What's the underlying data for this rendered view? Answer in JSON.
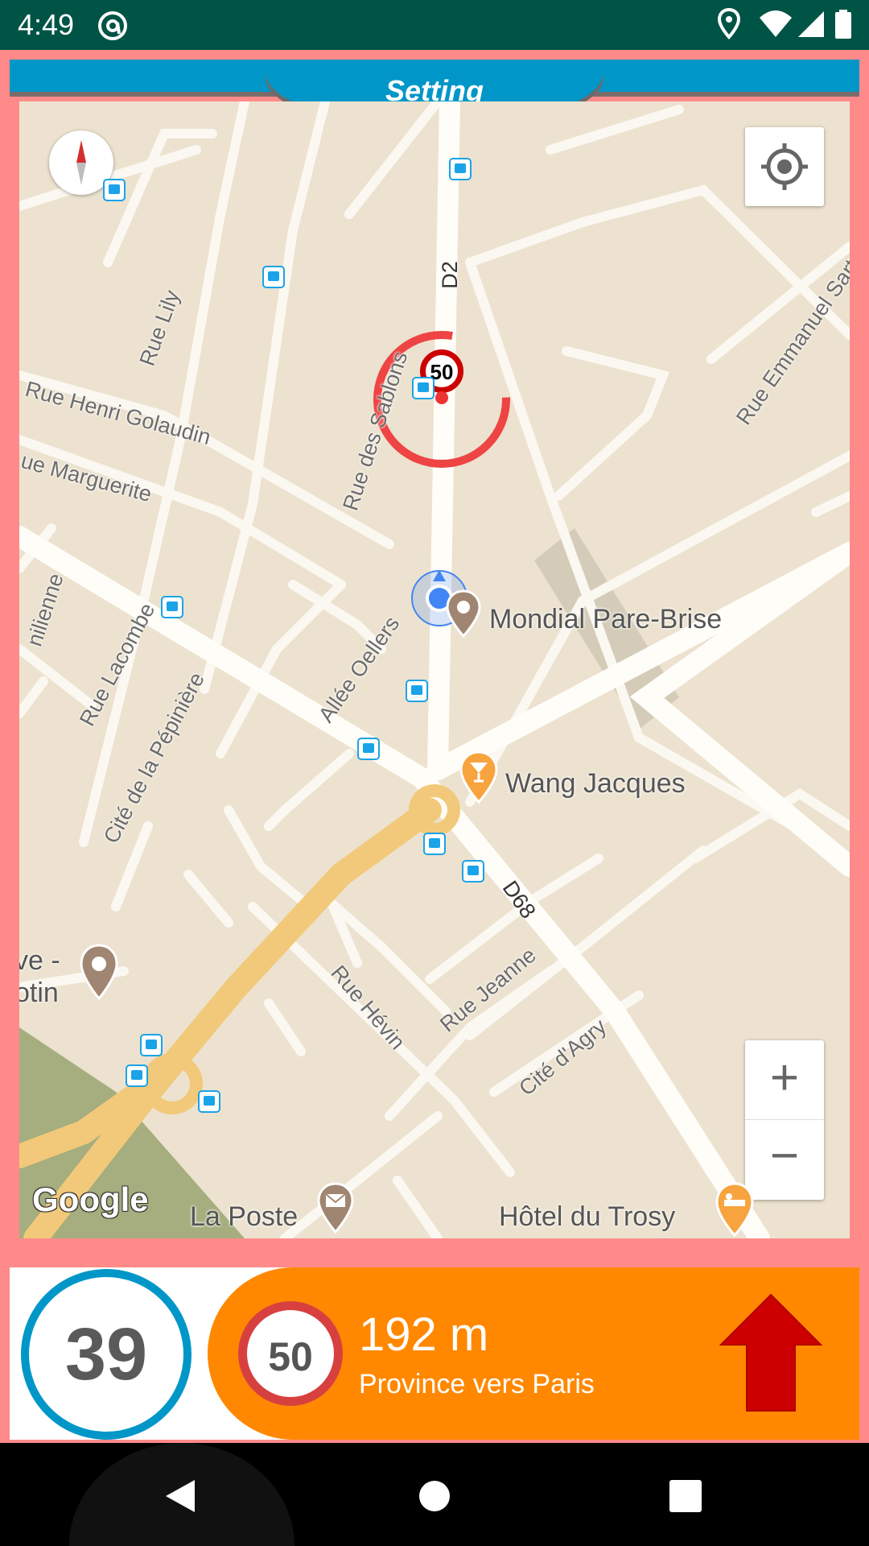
{
  "status_bar": {
    "time": "4:49"
  },
  "header": {
    "title": "Setting"
  },
  "map": {
    "street_labels": [
      "D2",
      "Rue Lily",
      "Rue Henri Golaudin",
      "ue Marguerite",
      "Rue des Sablons",
      "Rue Emmanuel Sartr",
      "nilienne",
      "Rue Lacombe",
      "Allée Oellers",
      "Cité de la Pépinière",
      "D68",
      "Rue Jeanne",
      "Rue Hévin",
      "Cité d'Agry"
    ],
    "pois": {
      "mondial": "Mondial Pare-Brise",
      "wang": "Wang Jacques",
      "laposte": "La Poste",
      "hotel": "Hôtel du Trosy",
      "cutoff1": "ve -",
      "cutoff2": "otin"
    },
    "speed_camera_limit": "50",
    "zoom_in_label": "+",
    "zoom_out_label": "−",
    "attribution": "Google"
  },
  "speed_panel": {
    "current_speed": "39",
    "limit": "50",
    "distance": "192 m",
    "direction": "Province vers Paris"
  },
  "colors": {
    "accent_blue": "#0096c8",
    "alert_orange": "#ff8800",
    "frame_pink": "#ff8a8a",
    "arrow_red": "#cc0000",
    "status_bar": "#005445"
  }
}
